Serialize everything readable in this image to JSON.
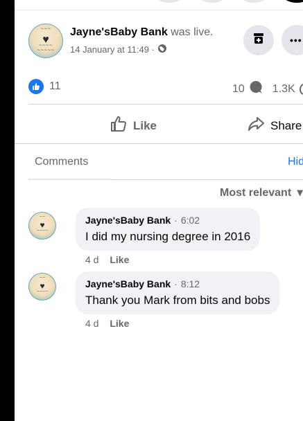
{
  "post": {
    "author": "Jayne'sBaby Bank",
    "action_text": "was live.",
    "timestamp": "14 January at 11:49 ·",
    "privacy_icon": "globe-icon",
    "save_icon": "archive-icon",
    "more_label": "•••"
  },
  "reactions": {
    "like_count": "11",
    "comments_count": "10",
    "views_count": "1.3K"
  },
  "actions": {
    "like_label": "Like",
    "share_label": "Share"
  },
  "comments_section": {
    "tab_label": "Comments",
    "hide_label": "Hid",
    "sort_label": "Most relevant"
  },
  "comments": [
    {
      "author": "Jayne'sBaby Bank",
      "time": "6:02",
      "text": "I did my nursing degree in 2016",
      "age": "4 d",
      "like_label": "Like"
    },
    {
      "author": "Jayne'sBaby Bank",
      "time": "8:12",
      "text": "Thank you Mark from bits and bobs",
      "age": "4 d",
      "like_label": "Like"
    }
  ],
  "colors": {
    "accent": "#1877f2",
    "muted": "#65676b",
    "bubble": "#f0f2f5"
  }
}
